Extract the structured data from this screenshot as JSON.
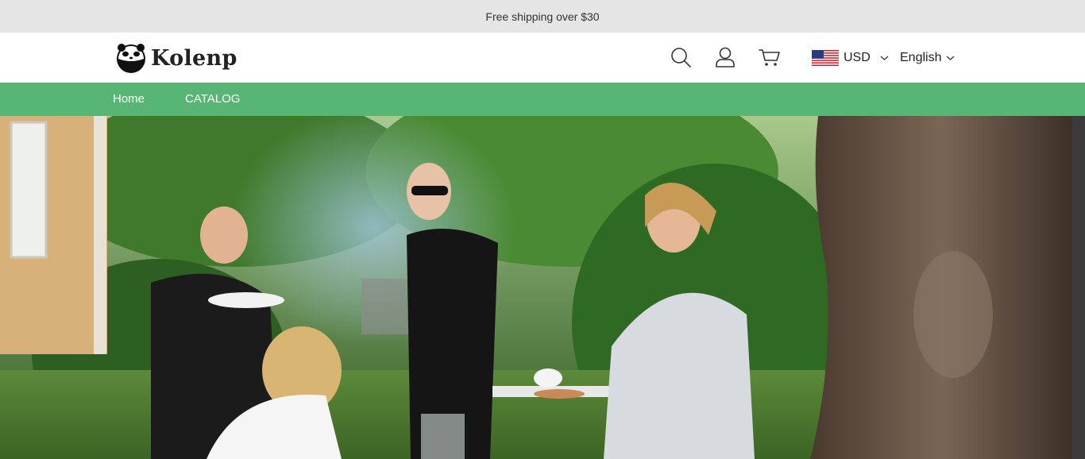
{
  "announcement": {
    "text": "Free shipping over $30"
  },
  "brand": {
    "name": "Kolenp"
  },
  "header": {
    "icons": [
      "search-icon",
      "account-icon",
      "cart-icon"
    ],
    "currency": {
      "label": "USD"
    },
    "language": {
      "label": "English"
    }
  },
  "nav": {
    "items": [
      {
        "label": "Home"
      },
      {
        "label": "CATALOG"
      }
    ]
  },
  "colors": {
    "announcement_bg": "#e5e5e5",
    "nav_bg": "#57b674",
    "nav_text": "#ffffff"
  }
}
